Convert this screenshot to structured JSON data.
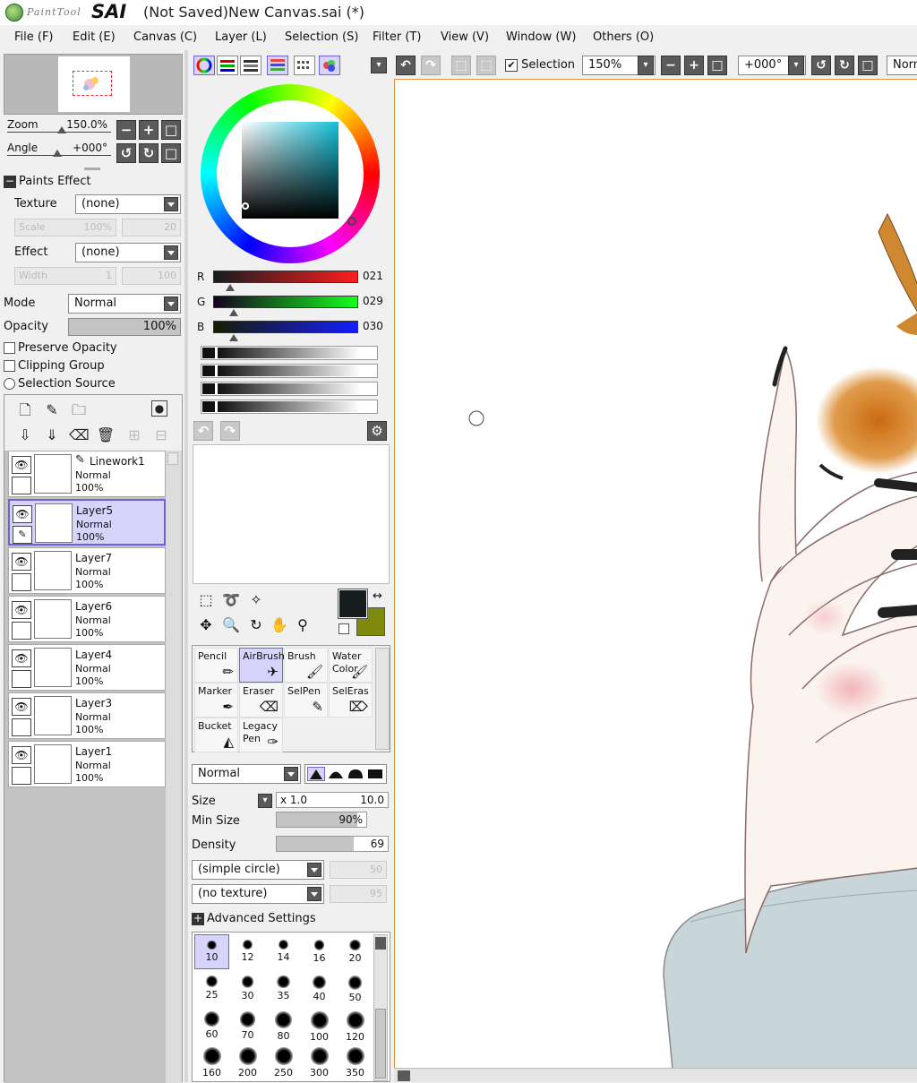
{
  "app": {
    "logo_small": "PaintTool",
    "logo_big": "SAI",
    "window_title": "(Not Saved)New Canvas.sai (*)"
  },
  "menu": [
    "File (F)",
    "Edit (E)",
    "Canvas (C)",
    "Layer (L)",
    "Selection (S)",
    "Filter (T)",
    "View (V)",
    "Window (W)",
    "Others (O)"
  ],
  "navigator": {
    "zoom_label": "Zoom",
    "zoom_value": "150.0%",
    "angle_label": "Angle",
    "angle_value": "+000°"
  },
  "paints_effect": {
    "header": "Paints Effect",
    "texture_label": "Texture",
    "texture_value": "(none)",
    "scale_label": "Scale",
    "scale_value": "100%",
    "scale_num": "20",
    "effect_label": "Effect",
    "effect_value": "(none)",
    "width_label": "Width",
    "width_value": "1",
    "width_num": "100"
  },
  "layer_props": {
    "mode_label": "Mode",
    "mode_value": "Normal",
    "opacity_label": "Opacity",
    "opacity_value": "100%",
    "preserve_opacity": "Preserve Opacity",
    "clipping_group": "Clipping Group",
    "selection_source": "Selection Source"
  },
  "layers": [
    {
      "name": "Linework1",
      "mode": "Normal",
      "opacity": "100%",
      "selected": false,
      "is_linework": true
    },
    {
      "name": "Layer5",
      "mode": "Normal",
      "opacity": "100%",
      "selected": true,
      "is_linework": false
    },
    {
      "name": "Layer7",
      "mode": "Normal",
      "opacity": "100%",
      "selected": false,
      "is_linework": false
    },
    {
      "name": "Layer6",
      "mode": "Normal",
      "opacity": "100%",
      "selected": false,
      "is_linework": false
    },
    {
      "name": "Layer4",
      "mode": "Normal",
      "opacity": "100%",
      "selected": false,
      "is_linework": false
    },
    {
      "name": "Layer3",
      "mode": "Normal",
      "opacity": "100%",
      "selected": false,
      "is_linework": false
    },
    {
      "name": "Layer1",
      "mode": "Normal",
      "opacity": "100%",
      "selected": false,
      "is_linework": false
    }
  ],
  "color": {
    "r_label": "R",
    "r_value": "021",
    "g_label": "G",
    "g_value": "029",
    "b_label": "B",
    "b_value": "030",
    "foreground": "#151d1e",
    "background": "#7f8a0d"
  },
  "tools": [
    {
      "label": "Pencil",
      "icon": "pencil-icon",
      "active": false
    },
    {
      "label": "AirBrush",
      "icon": "airbrush-icon",
      "active": true
    },
    {
      "label": "Brush",
      "icon": "brush-icon",
      "active": false
    },
    {
      "label": "Water\nColor",
      "icon": "watercolor-icon",
      "active": false
    },
    {
      "label": "Marker",
      "icon": "marker-icon",
      "active": false
    },
    {
      "label": "Eraser",
      "icon": "eraser-icon",
      "active": false
    },
    {
      "label": "SelPen",
      "icon": "selpen-icon",
      "active": false
    },
    {
      "label": "SelEras",
      "icon": "seleras-icon",
      "active": false
    },
    {
      "label": "Bucket",
      "icon": "bucket-icon",
      "active": false
    },
    {
      "label": "Legacy\nPen",
      "icon": "legacy-pen-icon",
      "active": false
    }
  ],
  "brush_settings": {
    "blend_mode": "Normal",
    "size_label": "Size",
    "size_mult": "x 1.0",
    "size_value": "10.0",
    "min_size_label": "Min Size",
    "min_size_value": "90%",
    "min_size_fraction": 0.9,
    "density_label": "Density",
    "density_value": "69",
    "density_fraction": 0.69,
    "shape_value": "(simple circle)",
    "shape_num": "50",
    "texture_value": "(no texture)",
    "texture_num": "95",
    "advanced_label": "Advanced Settings"
  },
  "brush_tips": [
    "10",
    "12",
    "14",
    "16",
    "20",
    "25",
    "30",
    "35",
    "40",
    "50",
    "60",
    "70",
    "80",
    "100",
    "120",
    "160",
    "200",
    "250",
    "300",
    "350"
  ],
  "canvas_toolbar": {
    "selection_label": "Selection",
    "zoom_value": "150%",
    "angle_value": "+000°",
    "mode_value": "Norm"
  }
}
